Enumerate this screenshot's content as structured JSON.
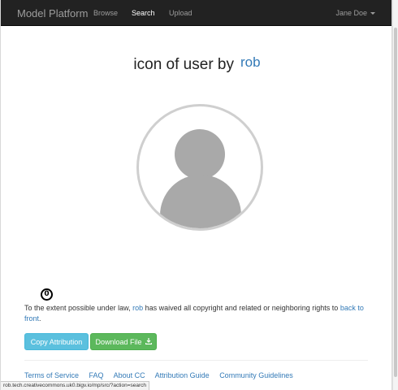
{
  "navbar": {
    "brand": "Model Platform",
    "links": [
      "Browse",
      "Search",
      "Upload"
    ],
    "active_link": "Search",
    "user": "Jane Doe"
  },
  "page": {
    "title_prefix": "icon of user by",
    "author": "rob"
  },
  "license": {
    "badge": "0",
    "text_before": "To the extent possible under law,",
    "author_link": "rob",
    "text_after": "has waived all copyright and related or neighboring rights to",
    "work_link": "back to front",
    "period": "."
  },
  "buttons": {
    "copy": "Copy Attribution",
    "download": "Download File"
  },
  "footer": {
    "links": [
      "Terms of Service",
      "FAQ",
      "About CC",
      "Attribution Guide",
      "Community Guidelines"
    ]
  },
  "status_bar": {
    "url": "rob.tech.creativecommons.uk0.bigv.io/mp/src/?action=search"
  },
  "colors": {
    "navbar_bg": "#222222",
    "link": "#337ab7",
    "copy_button": "#5bc0de",
    "download_button": "#5cb85c"
  },
  "icons": {
    "avatar": "user-silhouette-icon",
    "license": "cc-zero-icon",
    "download": "download-icon",
    "dropdown": "caret-down-icon"
  }
}
